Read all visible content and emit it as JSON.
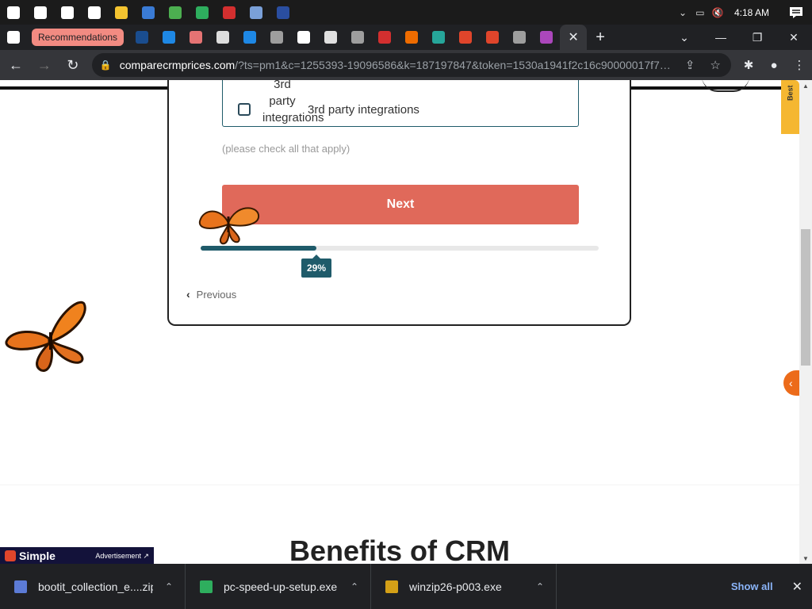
{
  "taskbar": {
    "icons": [
      {
        "name": "windows-start-icon",
        "color": "#ffffff"
      },
      {
        "name": "search-icon",
        "color": "#ffffff"
      },
      {
        "name": "cortana-icon",
        "color": "#ffffff"
      },
      {
        "name": "task-view-icon",
        "color": "#ffffff"
      },
      {
        "name": "file-explorer-icon",
        "color": "#f4c430"
      },
      {
        "name": "store-icon",
        "color": "#3a7bd5"
      },
      {
        "name": "chrome-icon",
        "color": "#4caf50"
      },
      {
        "name": "pc-speedup-icon",
        "color": "#2eae5e"
      },
      {
        "name": "avira-icon",
        "color": "#d32f2f"
      },
      {
        "name": "app-icon",
        "color": "#7aa0d8"
      },
      {
        "name": "shield-app-icon",
        "color": "#2a4ea0"
      }
    ],
    "clock": "4:18 AM"
  },
  "tabs": {
    "group_label": "Recommendations",
    "favicons_before": [
      {
        "name": "google-favicon-icon",
        "color": "#ffffff"
      }
    ],
    "favicons": [
      {
        "name": "wa-favicon-icon",
        "color": "#1a4d8f"
      },
      {
        "name": "slash-favicon-icon",
        "color": "#1e88e5"
      },
      {
        "name": "house-favicon-icon",
        "color": "#e57373"
      },
      {
        "name": "chrome-favicon-icon",
        "color": "#dddddd"
      },
      {
        "name": "slash-favicon-icon",
        "color": "#1e88e5"
      },
      {
        "name": "globe-favicon-icon",
        "color": "#9e9e9e"
      },
      {
        "name": "google-favicon-icon",
        "color": "#ffffff"
      },
      {
        "name": "camera-favicon-icon",
        "color": "#e0e0e0"
      },
      {
        "name": "globe-favicon-icon",
        "color": "#9e9e9e"
      },
      {
        "name": "avira-favicon-icon",
        "color": "#d32f2f"
      },
      {
        "name": "cloud-favicon-icon",
        "color": "#ef6c00"
      },
      {
        "name": "translate-favicon-icon",
        "color": "#26a69a"
      },
      {
        "name": "simple-favicon-icon",
        "color": "#e0452b"
      },
      {
        "name": "simple-favicon-icon",
        "color": "#e0452b"
      },
      {
        "name": "globe-favicon-icon",
        "color": "#9e9e9e"
      },
      {
        "name": "colorful-favicon-icon",
        "color": "#ab47bc"
      }
    ],
    "active_close": "✕",
    "new_tab": "+"
  },
  "address_bar": {
    "host": "comparecrmprices.com",
    "path": "/?ts=pm1&c=1255393-19096586&k=187197847&token=1530a1941f2c16c90000017f7d..."
  },
  "form": {
    "option_img_alt": "3rd party integrations",
    "option_label": "3rd party integrations",
    "hint": "(please check all that apply)",
    "next_label": "Next",
    "progress_value": 29,
    "progress_text": "29%",
    "previous_label": "Previous"
  },
  "page": {
    "section_title": "Benefits of CRM",
    "side_tab_label": "Best",
    "accent_color": "#1f5b6a",
    "button_color": "#e0695a"
  },
  "ad": {
    "brand": "Simple",
    "label": "Advertisement ↗"
  },
  "downloads": {
    "items": [
      {
        "name": "bootit_collection_e....zip",
        "icon_color": "#5c7bd6"
      },
      {
        "name": "pc-speed-up-setup.exe",
        "icon_color": "#2eae5e"
      },
      {
        "name": "winzip26-p003.exe",
        "icon_color": "#d4a017"
      }
    ],
    "show_all": "Show all"
  }
}
